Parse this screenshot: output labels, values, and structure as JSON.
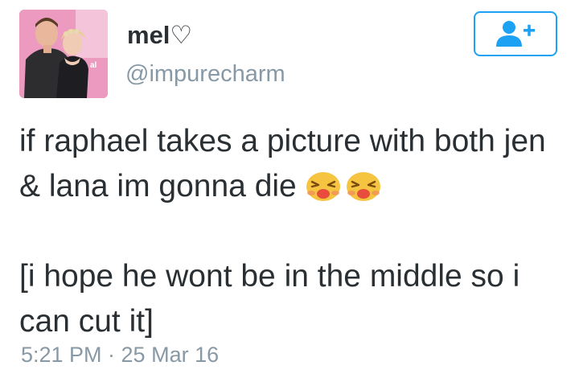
{
  "tweet": {
    "user": {
      "display_name": "mel♡",
      "handle": "@impurecharm",
      "avatar_icon": "profile-photo"
    },
    "follow_button": {
      "icon": "follow-user-plus-icon",
      "color": "#1da1f2"
    },
    "text": {
      "line1": "if raphael takes a picture with both jen & lana im gonna die",
      "emojis": [
        "tired-face-emoji",
        "tired-face-emoji"
      ],
      "line2": "[i hope he wont be in the middle so i can cut it]"
    },
    "timestamp": "5:21 PM · 25 Mar 16"
  },
  "colors": {
    "text": "#292f33",
    "muted": "#8899a6",
    "accent": "#1da1f2"
  }
}
